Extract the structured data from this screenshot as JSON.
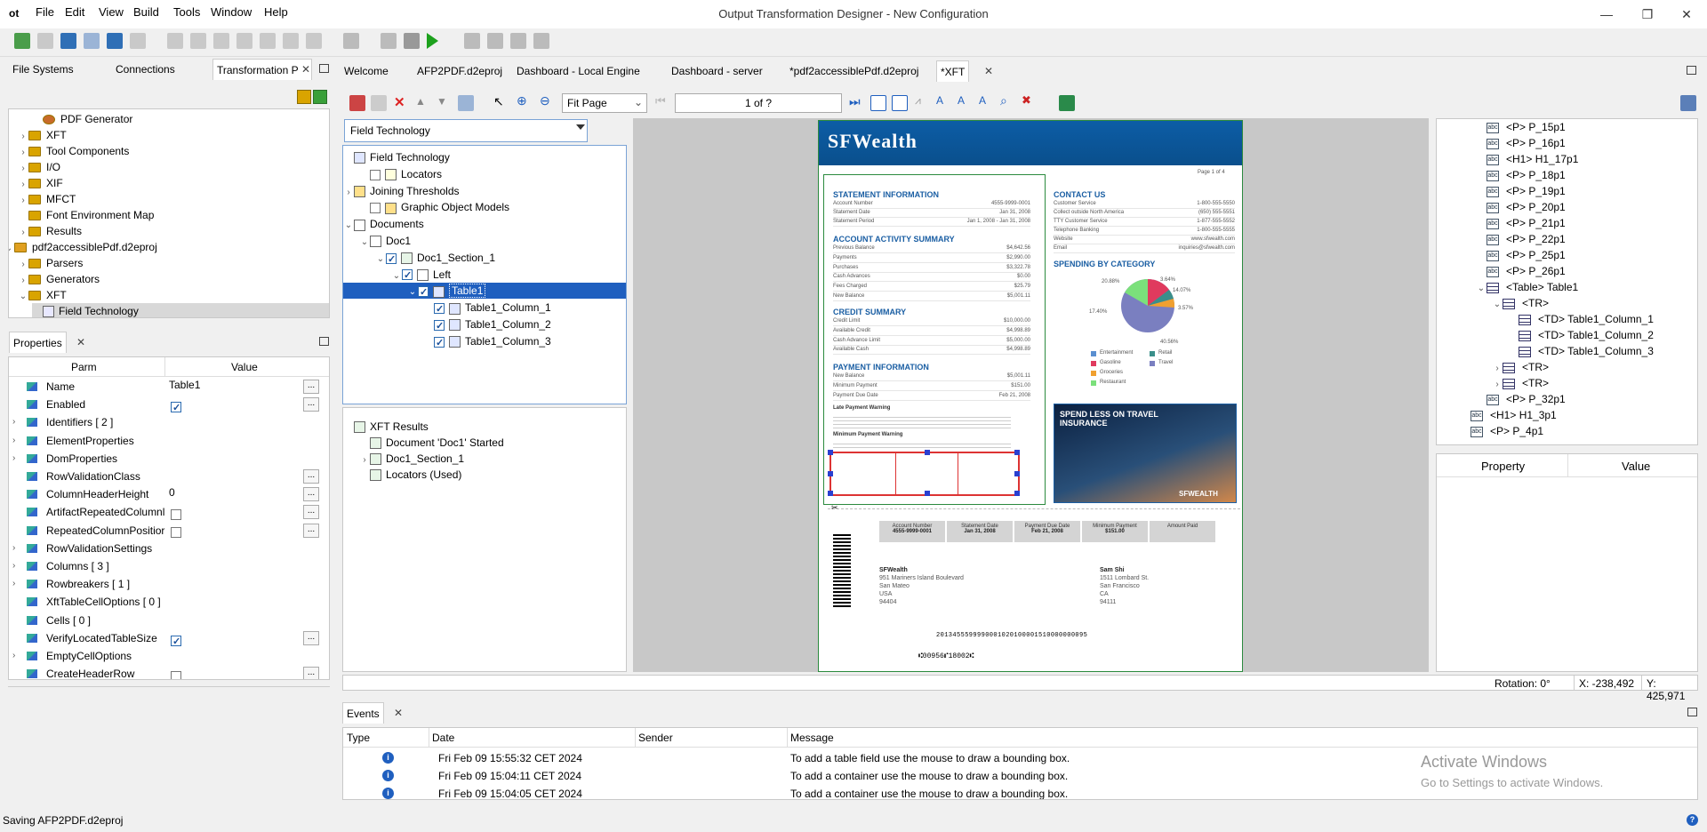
{
  "app": {
    "logo": "ot",
    "title": "Output Transformation Designer - New Configuration"
  },
  "menu": [
    "File",
    "Edit",
    "View",
    "Build",
    "Tools",
    "Window",
    "Help"
  ],
  "left_tabs": [
    "File Systems",
    "Connections",
    "Transformation P"
  ],
  "left_tree": [
    {
      "label": "PDF Generator",
      "indent": 3,
      "icon": "gear",
      "chev": ""
    },
    {
      "label": "XFT",
      "indent": 2,
      "icon": "folder",
      "chev": "›"
    },
    {
      "label": "Tool Components",
      "indent": 2,
      "icon": "folder",
      "chev": "›"
    },
    {
      "label": "I/O",
      "indent": 2,
      "icon": "folder",
      "chev": "›"
    },
    {
      "label": "XIF",
      "indent": 2,
      "icon": "folder",
      "chev": "›"
    },
    {
      "label": "MFCT",
      "indent": 2,
      "icon": "folder",
      "chev": "›"
    },
    {
      "label": "Font Environment Map",
      "indent": 2,
      "icon": "folder",
      "chev": ""
    },
    {
      "label": "Results",
      "indent": 2,
      "icon": "folder",
      "chev": "›"
    },
    {
      "label": "pdf2accessiblePdf.d2eproj",
      "indent": 1,
      "icon": "project",
      "chev": "⌄"
    },
    {
      "label": "Parsers",
      "indent": 2,
      "icon": "folder",
      "chev": "›"
    },
    {
      "label": "Generators",
      "indent": 2,
      "icon": "folder",
      "chev": "›"
    },
    {
      "label": "XFT",
      "indent": 2,
      "icon": "folder",
      "chev": "⌄"
    },
    {
      "label": "Field Technology",
      "indent": 3,
      "icon": "xft",
      "chev": ""
    }
  ],
  "properties": {
    "tab": "Properties",
    "headers": [
      "Parm",
      "Value"
    ],
    "rows": [
      {
        "name": "Name",
        "value": "Table1",
        "kind": "text",
        "chev": false,
        "btn": true
      },
      {
        "name": "Enabled",
        "value": "",
        "kind": "check-on",
        "chev": false,
        "btn": true
      },
      {
        "name": "Identifiers [ 2 ]",
        "value": "",
        "kind": "none",
        "chev": true,
        "btn": false
      },
      {
        "name": "ElementProperties",
        "value": "",
        "kind": "none",
        "chev": true,
        "btn": false
      },
      {
        "name": "DomProperties",
        "value": "",
        "kind": "none",
        "chev": true,
        "btn": false
      },
      {
        "name": "RowValidationClass",
        "value": "",
        "kind": "none",
        "chev": false,
        "btn": true
      },
      {
        "name": "ColumnHeaderHeight",
        "value": "0",
        "kind": "text",
        "chev": false,
        "btn": true
      },
      {
        "name": "ArtifactRepeatedColumnl",
        "value": "",
        "kind": "check-off",
        "chev": false,
        "btn": true
      },
      {
        "name": "RepeatedColumnPositior",
        "value": "",
        "kind": "check-off",
        "chev": false,
        "btn": true
      },
      {
        "name": "RowValidationSettings",
        "value": "",
        "kind": "none",
        "chev": true,
        "btn": false
      },
      {
        "name": "Columns [ 3 ]",
        "value": "",
        "kind": "none",
        "chev": true,
        "btn": false
      },
      {
        "name": "Rowbreakers [ 1 ]",
        "value": "",
        "kind": "none",
        "chev": true,
        "btn": false
      },
      {
        "name": "XftTableCellOptions [ 0 ]",
        "value": "",
        "kind": "none",
        "chev": false,
        "btn": false
      },
      {
        "name": "Cells [ 0 ]",
        "value": "",
        "kind": "none",
        "chev": false,
        "btn": false
      },
      {
        "name": "VerifyLocatedTableSize",
        "value": "",
        "kind": "check-on",
        "chev": false,
        "btn": true
      },
      {
        "name": "EmptyCellOptions",
        "value": "",
        "kind": "none",
        "chev": true,
        "btn": false
      },
      {
        "name": "CreateHeaderRow",
        "value": "",
        "kind": "check-off",
        "chev": false,
        "btn": true
      }
    ]
  },
  "editor_tabs": [
    "Welcome",
    "AFP2PDF.d2eproj",
    "Dashboard - Local Engine",
    "Dashboard - server",
    "*pdf2accessiblePdf.d2eproj",
    "*XFT"
  ],
  "fit_page": "Fit Page",
  "page_of": "1 of ?",
  "combo": "Field Technology",
  "xft_tree": [
    {
      "label": "Field Technology",
      "indent": 0,
      "chev": "",
      "cb": "",
      "icon": "xft"
    },
    {
      "label": "Locators",
      "indent": 1,
      "chev": "",
      "cb": "off",
      "icon": "loc"
    },
    {
      "label": "Joining Thresholds",
      "indent": 0,
      "chev": "›",
      "cb": "",
      "icon": "jt"
    },
    {
      "label": "Graphic Object Models",
      "indent": 1,
      "chev": "",
      "cb": "off",
      "icon": "gom"
    },
    {
      "label": "Documents",
      "indent": 0,
      "chev": "⌄",
      "cb": "",
      "icon": "docs"
    },
    {
      "label": "Doc1",
      "indent": 1,
      "chev": "⌄",
      "cb": "",
      "icon": "doc"
    },
    {
      "label": "Doc1_Section_1",
      "indent": 2,
      "chev": "⌄",
      "cb": "on",
      "icon": "sec"
    },
    {
      "label": "Left",
      "indent": 3,
      "chev": "⌄",
      "cb": "on",
      "icon": "doc"
    },
    {
      "label": "Table1",
      "indent": 4,
      "chev": "⌄",
      "cb": "on",
      "icon": "tbl",
      "selected": true
    },
    {
      "label": "Table1_Column_1",
      "indent": 5,
      "chev": "",
      "cb": "on",
      "icon": "col"
    },
    {
      "label": "Table1_Column_2",
      "indent": 5,
      "chev": "",
      "cb": "on",
      "icon": "col"
    },
    {
      "label": "Table1_Column_3",
      "indent": 5,
      "chev": "",
      "cb": "on",
      "icon": "col"
    }
  ],
  "xft_results": [
    {
      "label": "XFT Results",
      "indent": 0,
      "chev": ""
    },
    {
      "label": "Document 'Doc1' Started",
      "indent": 1,
      "chev": ""
    },
    {
      "label": "Doc1_Section_1",
      "indent": 1,
      "chev": "›"
    },
    {
      "label": "Locators (Used)",
      "indent": 1,
      "chev": ""
    }
  ],
  "preview": {
    "brand": "SFWealth",
    "page_label": "Page 1 of 4",
    "s1": "STATEMENT INFORMATION",
    "s1_rows": [
      [
        "Account Number",
        "4555-9999-0001"
      ],
      [
        "Statement Date",
        "Jan 31, 2008"
      ],
      [
        "Statement Period",
        "Jan 1, 2008 - Jan 31, 2008"
      ]
    ],
    "s2": "ACCOUNT ACTIVITY SUMMARY",
    "s2_rows": [
      [
        "Previous Balance",
        "$4,642.56"
      ],
      [
        "Payments",
        "$2,990.00"
      ],
      [
        "Purchases",
        "$3,322.78"
      ],
      [
        "Cash Advances",
        "$0.00"
      ],
      [
        "Fees Charged",
        "$25.79"
      ],
      [
        "New Balance",
        "$5,001.11"
      ]
    ],
    "s3": "CREDIT SUMMARY",
    "s3_rows": [
      [
        "Credit Limit",
        "$10,000.00"
      ],
      [
        "Available Credit",
        "$4,998.89"
      ],
      [
        "Cash Advance Limit",
        "$5,000.00"
      ],
      [
        "Available Cash",
        "$4,998.89"
      ]
    ],
    "s4": "PAYMENT INFORMATION",
    "s4_rows": [
      [
        "New Balance",
        "$5,001.11"
      ],
      [
        "Minimum Payment",
        "$151.00"
      ],
      [
        "Payment Due Date",
        "Feb 21, 2008"
      ]
    ],
    "late": "Late Payment Warning",
    "minpay": "Minimum Payment Warning",
    "contact": "CONTACT US",
    "contact_rows": [
      [
        "Customer Service",
        "1-800-555-5550"
      ],
      [
        "Collect outside North America",
        "(650) 555-5551"
      ],
      [
        "TTY Customer Service",
        "1-877-555-5552"
      ],
      [
        "Telephone Banking",
        "1-800-555-5555"
      ],
      [
        "Website",
        "www.sfwealth.com"
      ],
      [
        "Email",
        "inquiries@sfwealth.com"
      ]
    ],
    "spending": "SPENDING BY CATEGORY",
    "pie_labels": [
      "20.88%",
      "3.64%",
      "14.07%",
      "3.57%",
      "17.40%",
      "40.56%"
    ],
    "legend": [
      "Entertainment",
      "Retail",
      "Gasoline",
      "Travel",
      "Groceries",
      "Restaurant"
    ],
    "ad_title": "SPEND LESS ON TRAVEL INSURANCE",
    "ad_brand": "SFWEALTH",
    "stub_headers": [
      "Account Number",
      "Statement Date",
      "Payment Due Date",
      "Minimum Payment",
      "Amount Paid"
    ],
    "stub_values": [
      "4555-9999-0001",
      "Jan 31, 2008",
      "Feb 21, 2008",
      "$151.00",
      ""
    ],
    "from": [
      "SFWealth",
      "951 Mariners Island Boulevard",
      "San Mateo",
      "USA",
      "94404"
    ],
    "to": [
      "Sam Shi",
      "1511 Lombard St.",
      "San Francisco",
      "CA",
      "94111"
    ],
    "micr": "2013455599990001020100001510000000095",
    "micr2": "⑆00956⑈18002⑆"
  },
  "xml_tree": [
    {
      "label": "<P> P_15p1",
      "indent": 3,
      "icon": "abc"
    },
    {
      "label": "<P> P_16p1",
      "indent": 3,
      "icon": "abc"
    },
    {
      "label": "<H1> H1_17p1",
      "indent": 3,
      "icon": "abc"
    },
    {
      "label": "<P> P_18p1",
      "indent": 3,
      "icon": "abc"
    },
    {
      "label": "<P> P_19p1",
      "indent": 3,
      "icon": "abc"
    },
    {
      "label": "<P> P_20p1",
      "indent": 3,
      "icon": "abc"
    },
    {
      "label": "<P> P_21p1",
      "indent": 3,
      "icon": "abc"
    },
    {
      "label": "<P> P_22p1",
      "indent": 3,
      "icon": "abc"
    },
    {
      "label": "<P> P_25p1",
      "indent": 3,
      "icon": "abc"
    },
    {
      "label": "<P> P_26p1",
      "indent": 3,
      "icon": "abc"
    },
    {
      "label": "<Table> Table1",
      "indent": 3,
      "icon": "tbl",
      "chev": "⌄"
    },
    {
      "label": "<TR>",
      "indent": 4,
      "icon": "tbl",
      "chev": "⌄"
    },
    {
      "label": "<TD> Table1_Column_1",
      "indent": 5,
      "icon": "tbl"
    },
    {
      "label": "<TD> Table1_Column_2",
      "indent": 5,
      "icon": "tbl"
    },
    {
      "label": "<TD> Table1_Column_3",
      "indent": 5,
      "icon": "tbl"
    },
    {
      "label": "<TR>",
      "indent": 4,
      "icon": "tbl",
      "chev": "›"
    },
    {
      "label": "<TR>",
      "indent": 4,
      "icon": "tbl",
      "chev": "›"
    },
    {
      "label": "<P> P_32p1",
      "indent": 3,
      "icon": "abc"
    },
    {
      "label": "<H1> H1_3p1",
      "indent": 2,
      "icon": "abc"
    },
    {
      "label": "<P> P_4p1",
      "indent": 2,
      "icon": "abc"
    }
  ],
  "prop_headers": [
    "Property",
    "Value"
  ],
  "status": {
    "rotation": "Rotation: 0°",
    "x": "X: -238,492",
    "y": "Y: 425,971"
  },
  "events": {
    "tab": "Events",
    "headers": [
      "Type",
      "Date",
      "Sender",
      "Message"
    ],
    "rows": [
      {
        "date": "Fri Feb 09 15:55:32 CET 2024",
        "sender": "",
        "msg": "To add a table field use the mouse to draw a bounding box."
      },
      {
        "date": "Fri Feb 09 15:04:11 CET 2024",
        "sender": "",
        "msg": "To add a container use the mouse to draw a bounding box."
      },
      {
        "date": "Fri Feb 09 15:04:05 CET 2024",
        "sender": "",
        "msg": "To add a container use the mouse to draw a bounding box."
      }
    ]
  },
  "watermark": {
    "line1": "Activate Windows",
    "line2": "Go to Settings to activate Windows."
  },
  "bottom_status": "Saving AFP2PDF.d2eproj"
}
